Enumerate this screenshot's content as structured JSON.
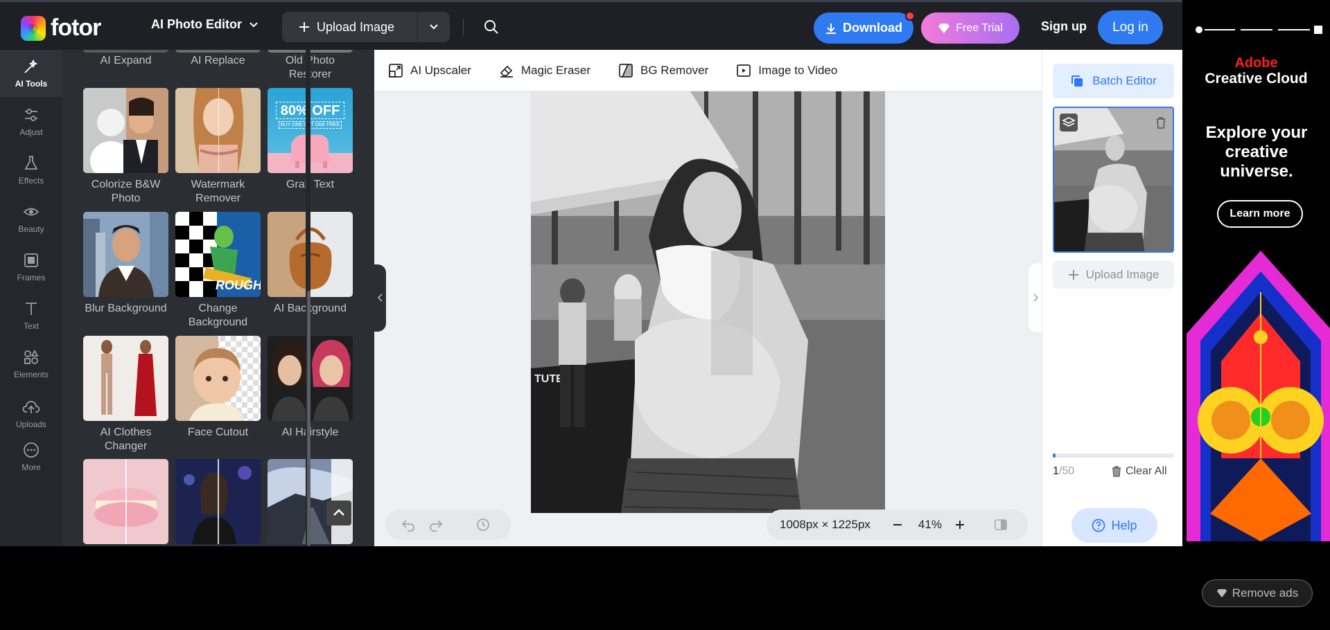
{
  "header": {
    "logo_text": "fotor",
    "editor_menu": "AI Photo Editor",
    "upload_button": "Upload Image",
    "download_button": "Download",
    "free_trial_button": "Free Trial",
    "signup_link": "Sign up",
    "login_button": "Log in"
  },
  "rail": {
    "items": [
      {
        "label": "AI Tools",
        "icon": "sparkle-icon"
      },
      {
        "label": "Adjust",
        "icon": "sliders-icon"
      },
      {
        "label": "Effects",
        "icon": "flask-icon"
      },
      {
        "label": "Beauty",
        "icon": "eye-icon"
      },
      {
        "label": "Frames",
        "icon": "frame-icon"
      },
      {
        "label": "Text",
        "icon": "text-icon"
      },
      {
        "label": "Elements",
        "icon": "shapes-icon"
      },
      {
        "label": "Uploads",
        "icon": "cloud-upload-icon"
      },
      {
        "label": "More",
        "icon": "more-icon"
      }
    ]
  },
  "tools_panel": {
    "top_row": [
      "AI Expand",
      "AI Replace",
      "Old Photo Restorer"
    ],
    "tiles": [
      {
        "label": "Colorize B&W Photo"
      },
      {
        "label": "Watermark Remover"
      },
      {
        "label": "Grab Text",
        "badge": "80% OFF",
        "sub_badge": "BUY ONE GET ONE FREE"
      },
      {
        "label": "Blur Background"
      },
      {
        "label": "Change Background",
        "badge": "ROUGH"
      },
      {
        "label": "AI Background"
      },
      {
        "label": "AI Clothes Changer"
      },
      {
        "label": "Face Cutout"
      },
      {
        "label": "AI Hairstyle"
      }
    ]
  },
  "toolbar": {
    "items": [
      {
        "label": "AI Upscaler",
        "icon": "upscale-icon"
      },
      {
        "label": "Magic Eraser",
        "icon": "eraser-icon"
      },
      {
        "label": "BG Remover",
        "icon": "bg-remove-icon"
      },
      {
        "label": "Image to Video",
        "icon": "video-icon"
      }
    ]
  },
  "canvas": {
    "dimensions": "1008px × 1225px",
    "zoom": "41%",
    "photo_sign_text": "TUTE"
  },
  "right_panel": {
    "batch_editor": "Batch Editor",
    "upload_image": "Upload Image",
    "count_current": "1",
    "count_total": "/50",
    "progress_fraction": 0.02,
    "clear_all": "Clear All",
    "help": "Help"
  },
  "ad": {
    "brand": "Adobe",
    "product": "Creative Cloud",
    "headline": "Explore your creative universe.",
    "cta": "Learn more",
    "remove_ads": "Remove ads"
  },
  "colors": {
    "accent": "#2f79f1",
    "topbar": "#1e2025",
    "panel": "#2b2e33",
    "ad_red": "#ff1f1f"
  }
}
